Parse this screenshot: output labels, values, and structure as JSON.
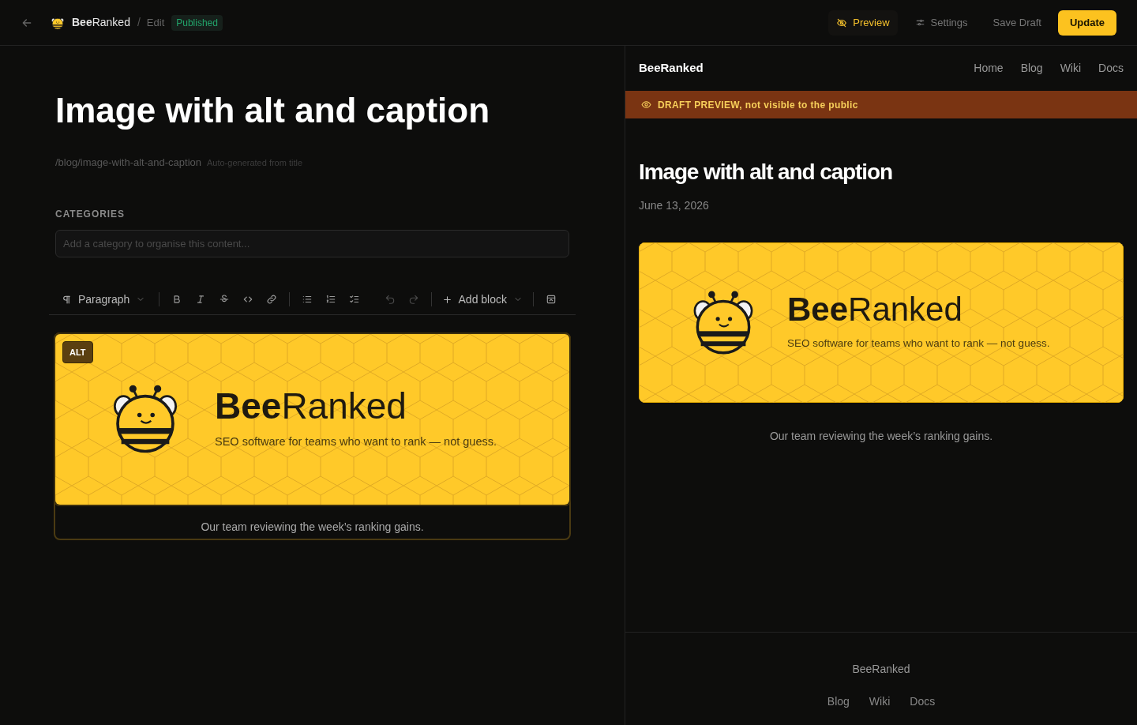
{
  "topbar": {
    "brand": "**Bee**Ranked",
    "separator": "/",
    "breadcrumb": "Edit",
    "status": "Published",
    "actions": [
      {
        "label": "Preview",
        "kind": "toggle",
        "selected": true
      },
      {
        "label": "Settings",
        "kind": "settings"
      },
      {
        "label": "Save Draft",
        "kind": "plain"
      },
      {
        "label": "Update",
        "kind": "primary"
      }
    ]
  },
  "editor": {
    "title": "Image with alt and caption",
    "slug": "/blog/image-with-alt-and-caption",
    "slug_hint": "Auto-generated from title",
    "categories_label": "CATEGORIES",
    "categories_field": {
      "placeholder": "Add a category to organise this content..."
    },
    "toolbar": {
      "block_type": "Paragraph",
      "add_block": "Add block"
    },
    "image_block": {
      "selected": true,
      "alt_badge": "ALT",
      "banner": {
        "brand": "**Bee**Ranked",
        "tagline": "SEO software for teams who want to rank — not guess."
      },
      "caption": "Our team reviewing the week’s ranking gains."
    }
  },
  "preview": {
    "site_name": "BeeRanked",
    "nav": [
      "Home",
      "Blog",
      "Wiki",
      "Docs"
    ],
    "draft_notice": "DRAFT PREVIEW, not visible to the public",
    "title": "Image with alt and caption",
    "date": "June 13, 2026",
    "banner": {
      "brand": "**Bee**Ranked",
      "tagline": "SEO software for teams who want to rank — not guess."
    },
    "caption": "Our team reviewing the week’s ranking gains.",
    "footer": {
      "site_name": "BeeRanked",
      "links": [
        "Blog",
        "Wiki",
        "Docs"
      ]
    }
  }
}
